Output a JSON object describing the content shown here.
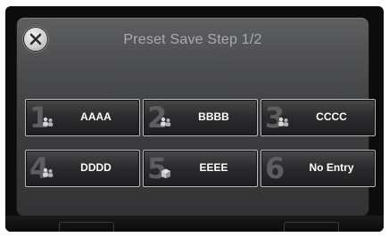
{
  "header": {
    "title": "Preset Save Step 1/2"
  },
  "icons": {
    "close": "close-icon",
    "person": "person-icon",
    "group": "group-icon",
    "box": "box-icon"
  },
  "presets": [
    {
      "number": "1",
      "name": "AAAA",
      "icon": "group"
    },
    {
      "number": "2",
      "name": "BBBB",
      "icon": "group"
    },
    {
      "number": "3",
      "name": "CCCC",
      "icon": "group"
    },
    {
      "number": "4",
      "name": "DDDD",
      "icon": "group"
    },
    {
      "number": "5",
      "name": "EEEE",
      "icon": "box"
    },
    {
      "number": "6",
      "name": "No Entry",
      "icon": ""
    }
  ],
  "colors": {
    "button_border": "#b9babb",
    "title_text": "#a9aaac",
    "label_text": "#ffffff"
  }
}
